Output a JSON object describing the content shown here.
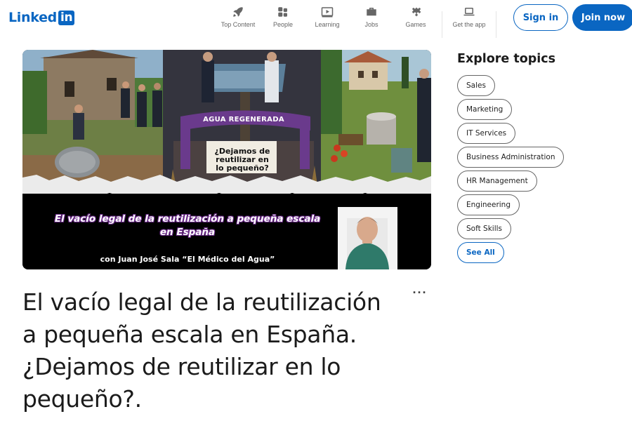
{
  "header": {
    "logo_text": "Linked",
    "logo_badge": "in",
    "nav": [
      {
        "label": "Top Content",
        "icon": "rocket-icon"
      },
      {
        "label": "People",
        "icon": "people-icon"
      },
      {
        "label": "Learning",
        "icon": "video-play-icon"
      },
      {
        "label": "Jobs",
        "icon": "briefcase-icon"
      },
      {
        "label": "Games",
        "icon": "puzzle-icon"
      },
      {
        "label": "Get the app",
        "icon": "laptop-icon"
      }
    ],
    "signin_label": "Sign in",
    "join_label": "Join now"
  },
  "hero": {
    "banner_text": "AGUA REGENERADA",
    "sign_text": "¿Dejamos de reutilizar en lo pequeño?",
    "caption_line1": "El vacío legal de la reutilización a pequeña escala",
    "caption_line2": "en España",
    "subcaption": "con Juan José Sala “El Médico del Agua”"
  },
  "article": {
    "title": "El vacío legal de la reutilización a pequeña escala en España. ¿Dejamos de reutilizar en lo pequeño?.",
    "more_label": "···"
  },
  "explore": {
    "title": "Explore topics",
    "topics": [
      "Sales",
      "Marketing",
      "IT Services",
      "Business Administration",
      "HR Management",
      "Engineering",
      "Soft Skills"
    ],
    "see_all_label": "See All"
  },
  "colors": {
    "brand": "#0a66c2",
    "text": "#1b1b1b",
    "muted": "#666666"
  }
}
